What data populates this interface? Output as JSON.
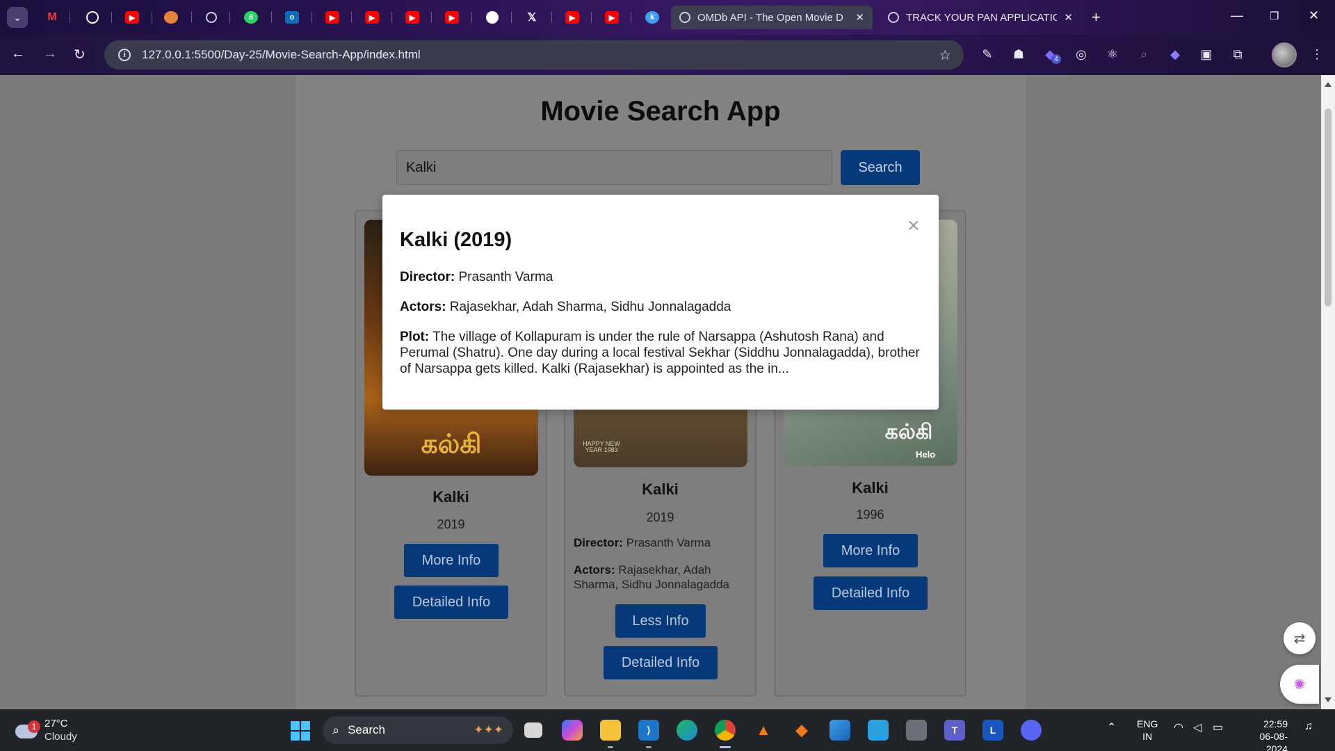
{
  "browser": {
    "tabs": [
      {
        "title": "OMDb API - The Open Movie D",
        "active": true
      },
      {
        "title": "TRACK YOUR PAN APPLICATION",
        "active": false
      }
    ],
    "close_glyph": "✕",
    "new_tab_glyph": "+",
    "url": "127.0.0.1:5500/Day-25/Movie-Search-App/index.html",
    "pinned_icons": [
      "gmail-icon",
      "openai-icon",
      "youtube-icon",
      "app-icon",
      "globe-icon",
      "whatsapp-icon",
      "outlook-icon",
      "youtube-icon",
      "youtube-icon",
      "youtube-icon",
      "youtube-icon",
      "github-icon",
      "x-icon",
      "youtube-icon",
      "youtube-icon",
      "k-icon"
    ],
    "extension_badge": "4"
  },
  "app": {
    "title": "Movie Search App",
    "search": {
      "value": "Kalki",
      "button_label": "Search"
    },
    "cards": [
      {
        "title": "Kalki",
        "year": "2019",
        "primary_button": "More Info",
        "secondary_button": "Detailed Info"
      },
      {
        "title": "Kalki",
        "year": "2019",
        "director_label": "Director:",
        "director": "Prasanth Varma",
        "actors_label": "Actors:",
        "actors": "Rajasekhar, Adah Sharma, Sidhu Jonnalagadda",
        "primary_button": "Less Info",
        "secondary_button": "Detailed Info",
        "poster_text": "HAPPY NEW YEAR 1983"
      },
      {
        "title": "Kalki",
        "year": "1996",
        "primary_button": "More Info",
        "secondary_button": "Detailed Info",
        "poster_text": "Helo"
      }
    ],
    "poster_titles": [
      "கல்கி",
      "கல்கி"
    ],
    "modal": {
      "close_glyph": "×",
      "title": "Kalki (2019)",
      "director_label": "Director:",
      "director": "Prasanth Varma",
      "actors_label": "Actors:",
      "actors": "Rajasekhar, Adah Sharma, Sidhu Jonnalagadda",
      "plot_label": "Plot:",
      "plot": "The village of Kollapuram is under the rule of Narsappa (Ashutosh Rana) and Perumal (Shatru). One day during a local festival Sekhar (Siddhu Jonnalagadda), brother of Narsappa gets killed. Kalki (Rajasekhar) is appointed as the in..."
    }
  },
  "taskbar": {
    "weather": {
      "temp": "27°C",
      "condition": "Cloudy",
      "badge": "1"
    },
    "search_label": "Search",
    "language": {
      "line1": "ENG",
      "line2": "IN"
    },
    "clock": {
      "time": "22:59",
      "date": "06-08-2024"
    }
  },
  "colors": {
    "accent_button": "#06397a",
    "overlay": "#7a7a7a"
  }
}
